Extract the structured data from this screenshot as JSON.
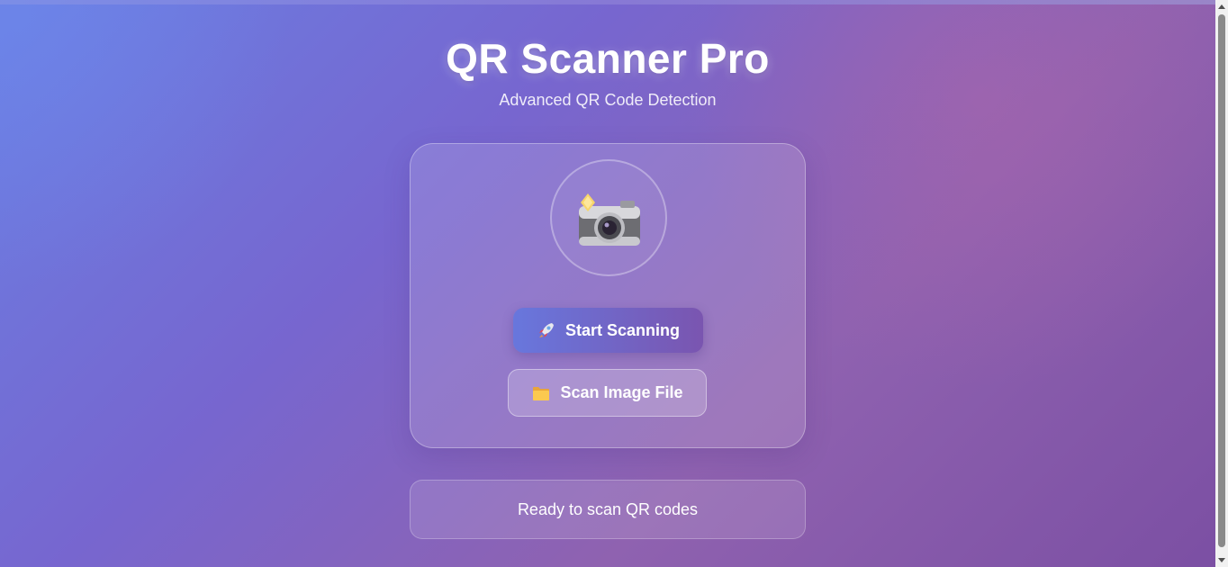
{
  "header": {
    "title": "QR Scanner Pro",
    "subtitle": "Advanced QR Code Detection"
  },
  "scanner_card": {
    "camera_icon": "camera-with-flash-icon",
    "start_button": {
      "icon": "rocket-icon",
      "label": "Start Scanning"
    },
    "file_button": {
      "icon": "folder-icon",
      "label": "Scan Image File"
    }
  },
  "status": {
    "text": "Ready to scan QR codes"
  },
  "colors": {
    "background_start": "#6a7fe3",
    "background_end": "#7b4fa3",
    "start_button_start": "#6877dd",
    "start_button_end": "#7a55b0"
  }
}
